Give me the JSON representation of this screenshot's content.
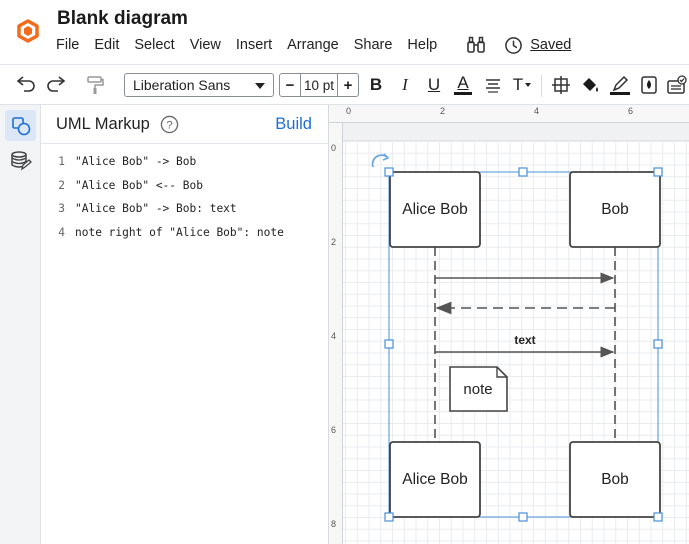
{
  "app": {
    "doc_title": "Blank diagram",
    "menu": [
      "File",
      "Edit",
      "Select",
      "View",
      "Insert",
      "Arrange",
      "Share",
      "Help"
    ],
    "saved_label": "Saved",
    "icons": {
      "logo": "lucid-logo-icon",
      "search": "binoculars-icon",
      "history": "clock-icon"
    },
    "accent_color": "#1f6ed4",
    "logo_color": "#f26b1d"
  },
  "toolbar": {
    "font_family": "Liberation Sans",
    "font_size": "10 pt",
    "decrement": "−",
    "increment": "+",
    "bold": "B",
    "italic": "I",
    "underline": "U",
    "text_color": "A",
    "text_options": "T"
  },
  "panel": {
    "title": "UML Markup",
    "build_label": "Build",
    "code_lines": [
      {
        "num": "1",
        "text": "\"Alice Bob\" -> Bob"
      },
      {
        "num": "2",
        "text": "\"Alice Bob\" <-- Bob"
      },
      {
        "num": "3",
        "text": "\"Alice Bob\" -> Bob: text"
      },
      {
        "num": "4",
        "text": "note right of \"Alice Bob\": note"
      }
    ]
  },
  "canvas": {
    "ruler_top": [
      "0",
      "2",
      "4",
      "6"
    ],
    "ruler_left": [
      "0",
      "2",
      "4",
      "6",
      "8"
    ],
    "participants": [
      "Alice Bob",
      "Bob"
    ],
    "message_label": "text",
    "note_text": "note",
    "selection_color": "#4a90d9"
  }
}
